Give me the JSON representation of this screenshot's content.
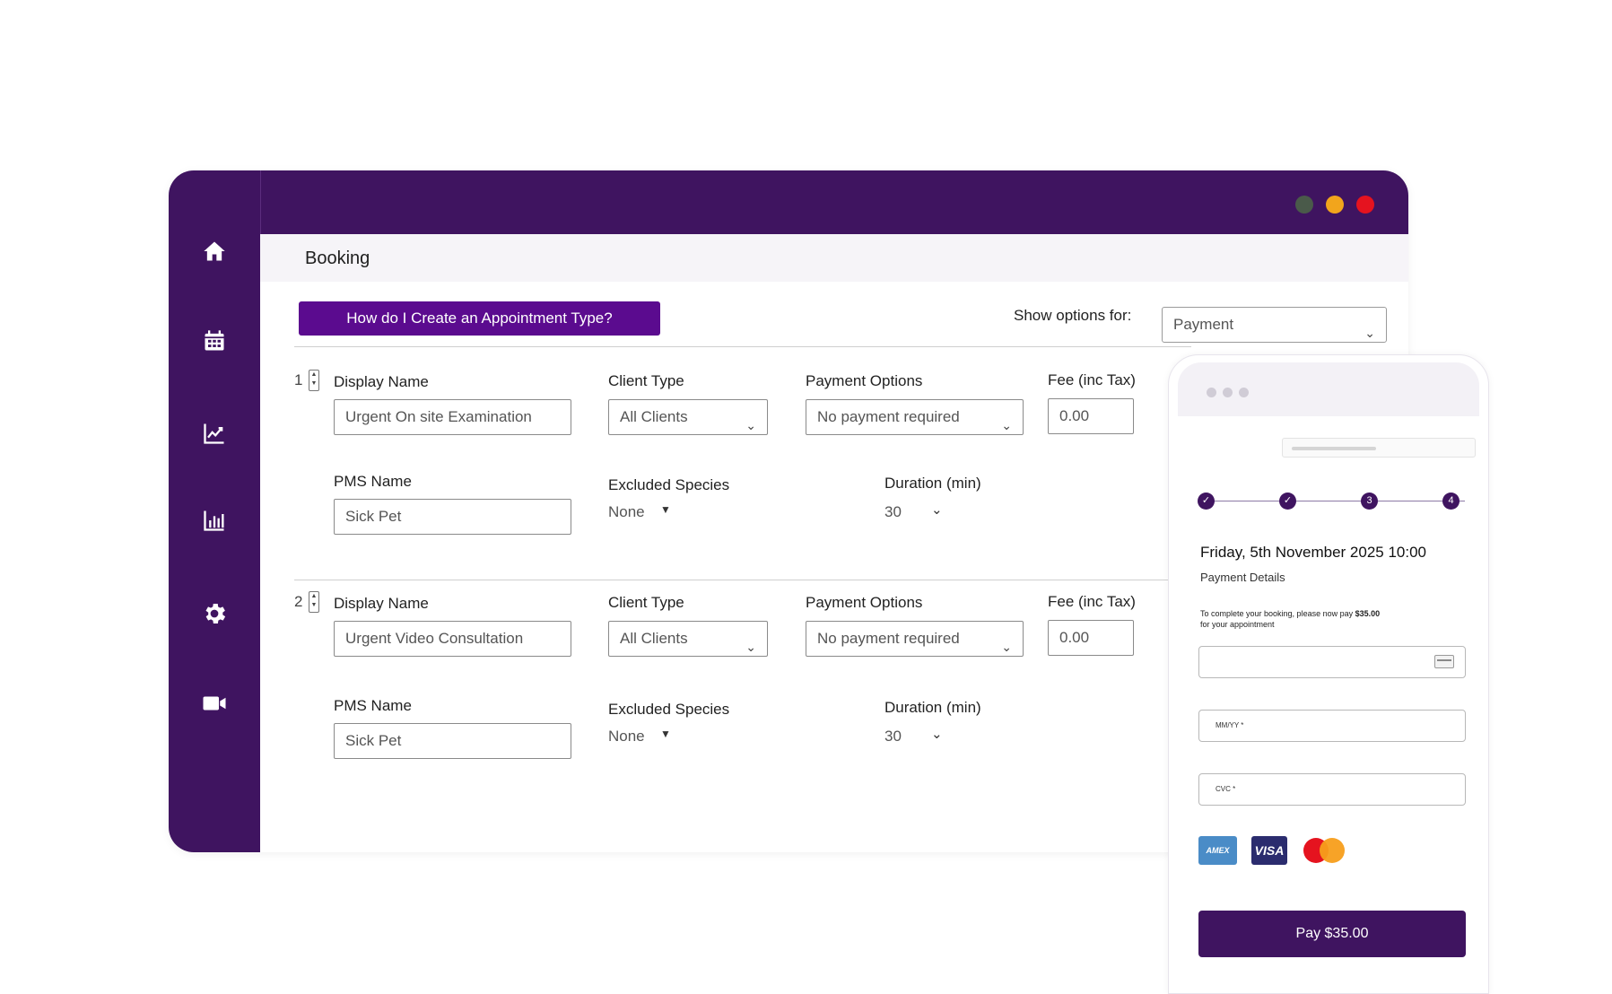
{
  "window": {
    "controls": [
      "minimize",
      "maximize",
      "close"
    ],
    "colors": {
      "sidebar": "#3f1460",
      "accent": "#5b0b8f",
      "dot_green": "#4a5a4a",
      "dot_yellow": "#f2a51c",
      "dot_red": "#e5131f"
    }
  },
  "sidebar": {
    "icons": [
      "home-icon",
      "calendar-icon",
      "trend-chart-icon",
      "bar-chart-icon",
      "gear-icon",
      "video-camera-icon"
    ]
  },
  "header": {
    "title": "Booking"
  },
  "toolbar": {
    "help_button": "How do I Create an Appointment Type?",
    "show_options_label": "Show options for:",
    "show_options_value": "Payment"
  },
  "appointments": [
    {
      "index": "1",
      "display_name_label": "Display Name",
      "display_name": "Urgent On site Examination",
      "client_type_label": "Client Type",
      "client_type": "All Clients",
      "payment_options_label": "Payment Options",
      "payment_option": "No payment required",
      "fee_label": "Fee (inc Tax)",
      "fee": "0.00",
      "pms_name_label": "PMS Name",
      "pms_name": "Sick Pet",
      "excluded_species_label": "Excluded Species",
      "excluded_species": "None",
      "duration_label": "Duration (min)",
      "duration": "30"
    },
    {
      "index": "2",
      "display_name_label": "Display Name",
      "display_name": "Urgent Video Consultation",
      "client_type_label": "Client Type",
      "client_type": "All Clients",
      "payment_options_label": "Payment Options",
      "payment_option": "No payment required",
      "fee_label": "Fee (inc Tax)",
      "fee": "0.00",
      "pms_name_label": "PMS Name",
      "pms_name": "Sick Pet",
      "excluded_species_label": "Excluded Species",
      "excluded_species": "None",
      "duration_label": "Duration (min)",
      "duration": "30"
    }
  ],
  "phone": {
    "steps": [
      "✓",
      "✓",
      "3",
      "4"
    ],
    "booking_datetime": "Friday, 5th November 2025 10:00",
    "section_title": "Payment Details",
    "note_prefix": "To complete your booking, please now pay ",
    "note_amount": "$35.00",
    "note_suffix": "for your appointment",
    "card_number_placeholder": "",
    "expiry_placeholder": "MM/YY *",
    "cvc_placeholder": "CVC *",
    "card_brands": [
      "AMEX",
      "VISA",
      "mastercard"
    ],
    "pay_button": "Pay $35.00"
  }
}
